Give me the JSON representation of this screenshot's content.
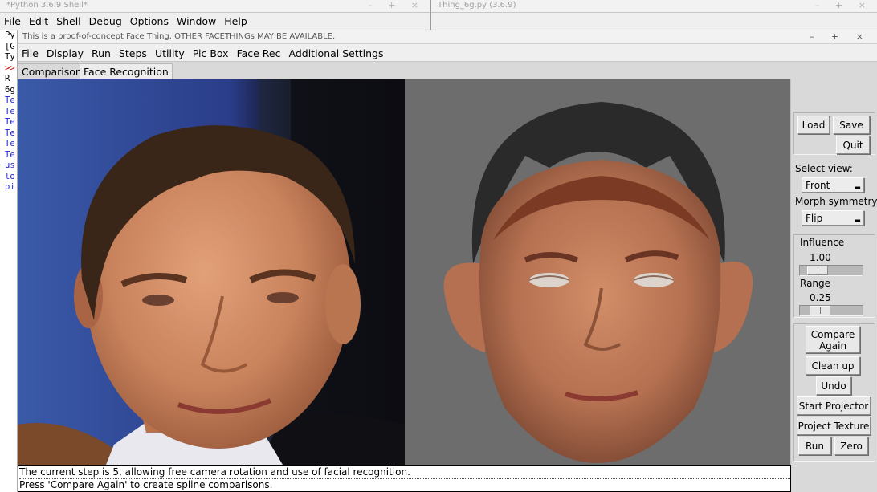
{
  "shell_window": {
    "title": "*Python 3.6.9 Shell*",
    "controls": "– + ×",
    "menu": [
      "File",
      "Edit",
      "Shell",
      "Debug",
      "Options",
      "Window",
      "Help"
    ],
    "lines": [
      {
        "text": "Py",
        "color": "black"
      },
      {
        "text": "[G",
        "color": "black"
      },
      {
        "text": "Ty",
        "color": "black"
      },
      {
        "text": ">>",
        "color": "red"
      },
      {
        "text": " R",
        "color": "black"
      },
      {
        "text": "6g",
        "color": "black"
      },
      {
        "text": "Te",
        "color": "blue"
      },
      {
        "text": "Te",
        "color": "blue"
      },
      {
        "text": "Te",
        "color": "blue"
      },
      {
        "text": "Te",
        "color": "blue"
      },
      {
        "text": "Te",
        "color": "blue"
      },
      {
        "text": "Te",
        "color": "blue"
      },
      {
        "text": "us",
        "color": "blue"
      },
      {
        "text": "lo",
        "color": "blue"
      },
      {
        "text": "pi",
        "color": "blue"
      }
    ]
  },
  "editor_window": {
    "title": "Thing_6g.py (3.6.9)",
    "controls": "– + ×"
  },
  "app_window": {
    "title": "This is a proof-of-concept Face Thing.  OTHER FACETHINGs MAY BE AVAILABLE.",
    "controls": "– + ×",
    "menu": [
      "File",
      "Display",
      "Run",
      "Steps",
      "Utility",
      "Pic Box",
      "Face Rec",
      "Additional Settings"
    ],
    "tabs": [
      {
        "label": "Comparisons",
        "active": false
      },
      {
        "label": "Face Recognition",
        "active": true
      }
    ]
  },
  "panel": {
    "load": "Load",
    "save": "Save",
    "quit": "Quit",
    "select_view_label": "Select view:",
    "select_view_value": "Front",
    "morph_symmetry_label": "Morph symmetry:",
    "morph_symmetry_value": "Flip",
    "influence_label": "Influence",
    "influence_value": "1.00",
    "range_label": "Range",
    "range_value": "0.25",
    "compare_again_l1": "Compare",
    "compare_again_l2": "Again",
    "clean_up": "Clean up",
    "undo": "Undo",
    "start_projector": "Start Projector",
    "project_texture": "Project Texture",
    "run": "Run",
    "zero": "Zero"
  },
  "status": {
    "line1": "The current step is 5, allowing free camera rotation and use of facial recognition.",
    "line2": "Press 'Compare Again' to create spline comparisons."
  },
  "colors": {
    "photo_background": "#2a3d8a",
    "render_background": "#6d6d6d",
    "skin": "#c8825c",
    "hair": "#2a2a2a",
    "shell_prompt": "#c00000",
    "shell_output": "#2020d0"
  }
}
